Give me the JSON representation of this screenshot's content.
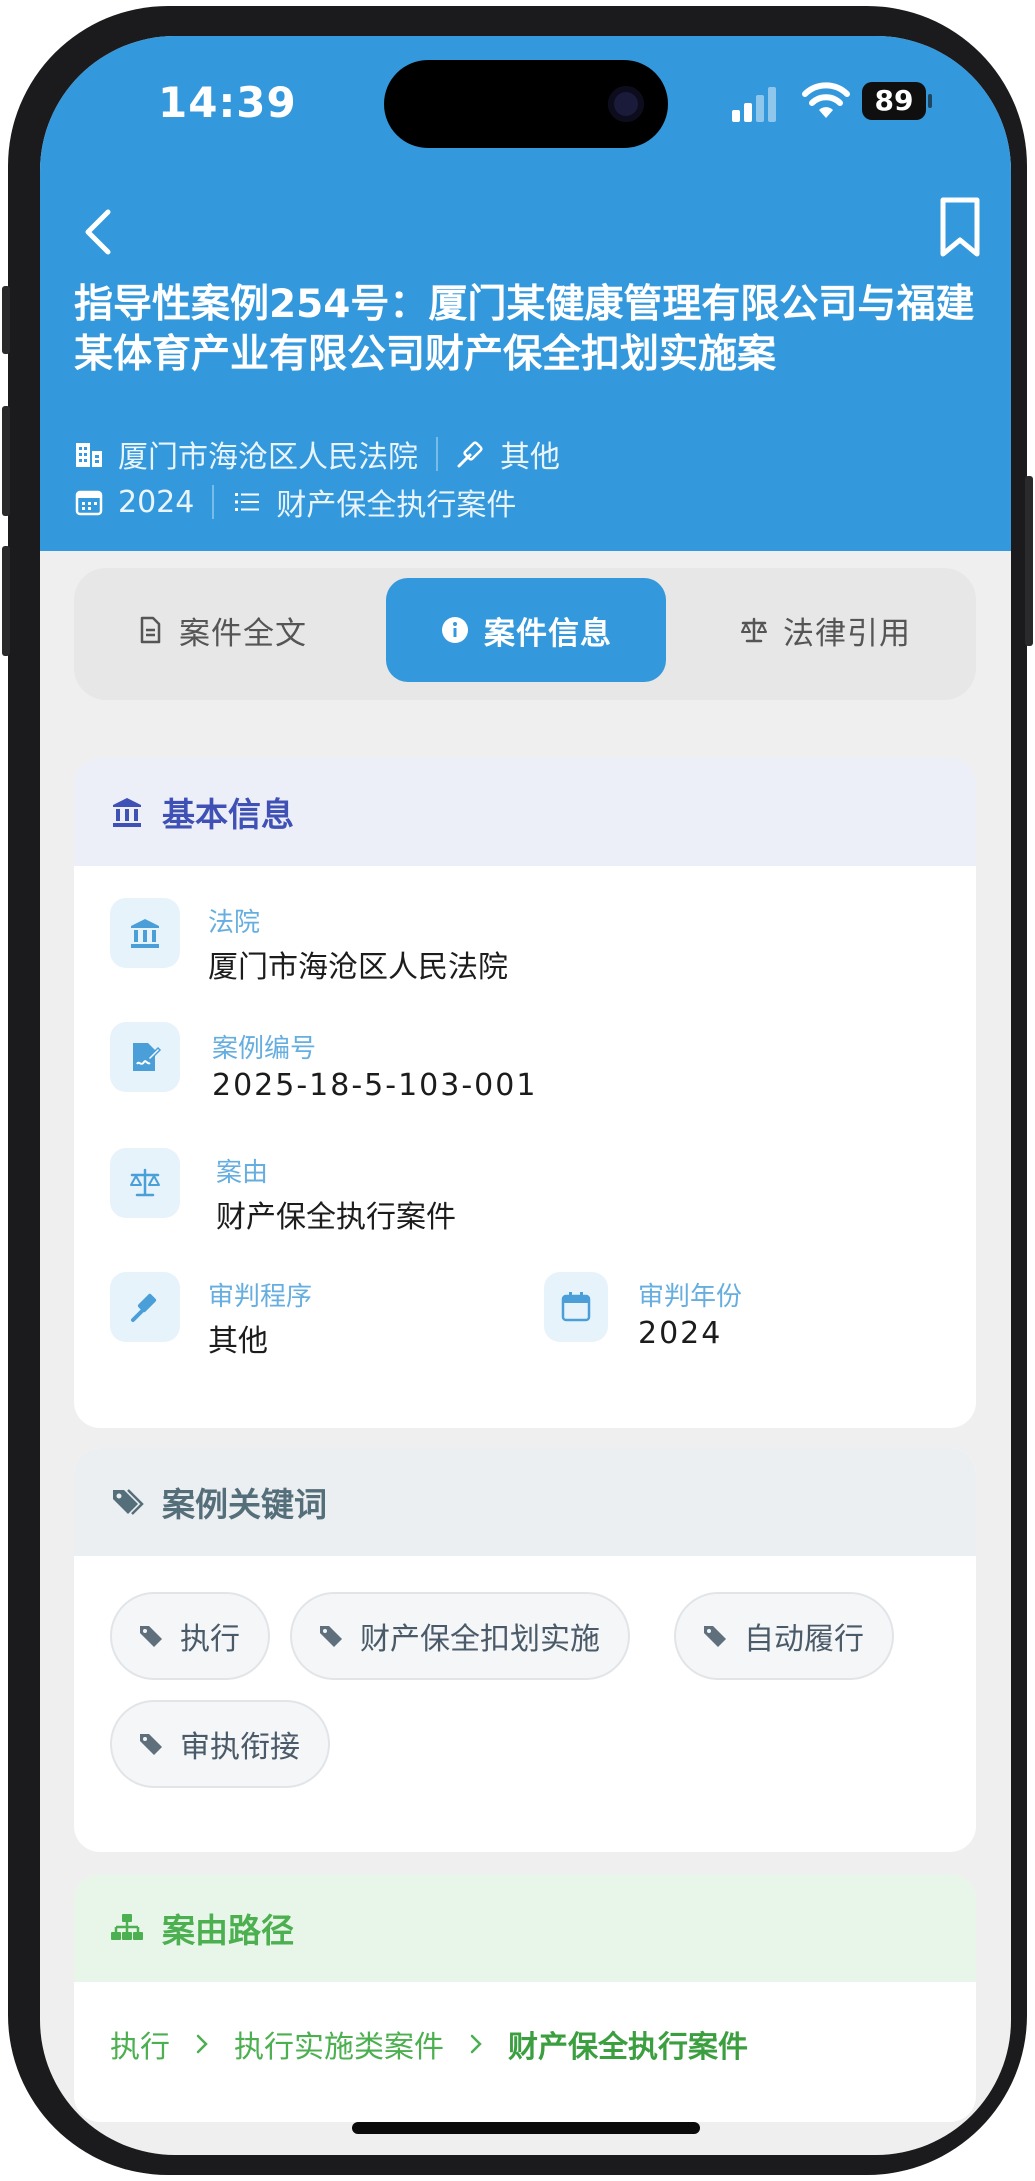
{
  "status_bar": {
    "time": "14:39",
    "battery": "89"
  },
  "header": {
    "title": "指导性案例254号：厦门某健康管理有限公司与福建某体育产业有限公司财产保全扣划实施案",
    "court": "厦门市海沧区人民法院",
    "procedure": "其他",
    "year": "2024",
    "case_type": "财产保全执行案件"
  },
  "tabs": [
    {
      "label": "案件全文",
      "icon": "document-icon"
    },
    {
      "label": "案件信息",
      "icon": "info-icon",
      "active": true
    },
    {
      "label": "法律引用",
      "icon": "scale-icon"
    }
  ],
  "basic_info": {
    "title": "基本信息",
    "fields": {
      "court": {
        "label": "法院",
        "value": "厦门市海沧区人民法院"
      },
      "case_no": {
        "label": "案例编号",
        "value": "2025-18-5-103-001"
      },
      "cause": {
        "label": "案由",
        "value": "财产保全执行案件"
      },
      "procedure": {
        "label": "审判程序",
        "value": "其他"
      },
      "year": {
        "label": "审判年份",
        "value": "2024"
      }
    }
  },
  "keywords": {
    "title": "案例关键词",
    "items": [
      "执行",
      "财产保全扣划实施",
      "自动履行",
      "审执衔接"
    ]
  },
  "cause_path": {
    "title": "案由路径",
    "items": [
      "执行",
      "执行实施类案件",
      "财产保全执行案件"
    ]
  },
  "colors": {
    "accent": "#3398dc",
    "basic_header_bg": "#eceef8",
    "basic_header_text": "#3f51b5",
    "keywords_header_bg": "#eceff1",
    "keywords_header_text": "#546e7a",
    "path_header_bg": "#e8f5e9",
    "path_text": "#4caf50"
  }
}
